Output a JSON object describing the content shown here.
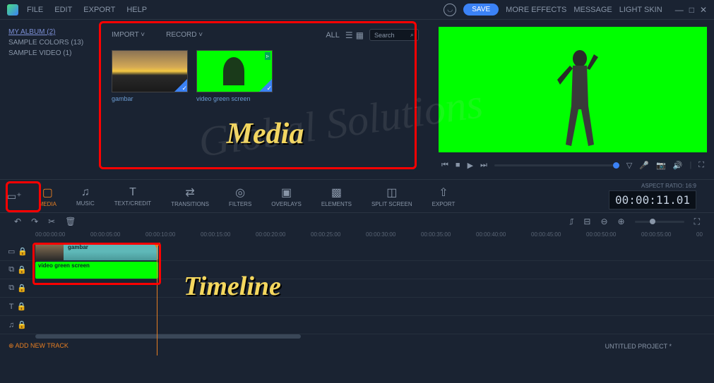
{
  "menu": {
    "file": "FILE",
    "edit": "EDIT",
    "export": "EXPORT",
    "help": "HELP"
  },
  "topbar": {
    "save": "SAVE",
    "more_effects": "MORE EFFECTS",
    "message": "MESSAGE",
    "light_skin": "LIGHT SKIN"
  },
  "sidebar": {
    "album": "MY ALBUM (2)",
    "colors": "SAMPLE COLORS (13)",
    "video": "SAMPLE VIDEO (1)"
  },
  "media_toolbar": {
    "import": "IMPORT",
    "record": "RECORD",
    "all": "ALL",
    "search": "Search"
  },
  "media_items": [
    {
      "name": "gambar"
    },
    {
      "name": "video green screen"
    }
  ],
  "annotation": {
    "media": "Media",
    "timeline": "Timeline"
  },
  "tabs": {
    "media": "MEDIA",
    "music": "MUSIC",
    "text": "TEXT/CREDIT",
    "transitions": "TRANSITIONS",
    "filters": "FILTERS",
    "overlays": "OVERLAYS",
    "elements": "ELEMENTS",
    "split": "SPLIT SCREEN",
    "export": "EXPORT"
  },
  "aspect": "ASPECT RATIO: 16:9",
  "timecode": "00:00:11.01",
  "ruler": [
    "00:00:00:00",
    "00:00:05:00",
    "00:00:10:00",
    "00:00:15:00",
    "00:00:20:00",
    "00:00:25:00",
    "00:00:30:00",
    "00:00:35:00",
    "00:00:40:00",
    "00:00:45:00",
    "00:00:50:00",
    "00:00:55:00",
    "00"
  ],
  "clips": {
    "c1": "gambar",
    "c2": "video green screen"
  },
  "add_track": "ADD NEW TRACK",
  "project": "UNTITLED PROJECT *",
  "watermark": "Global Solutions"
}
